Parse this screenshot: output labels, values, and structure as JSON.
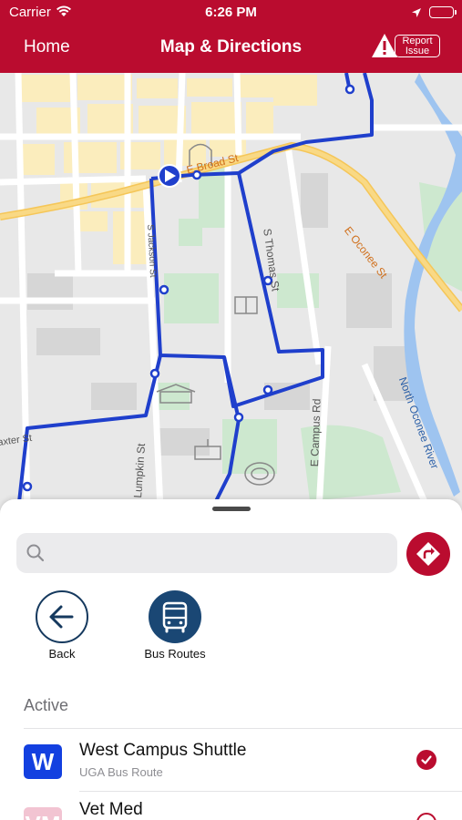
{
  "status_bar": {
    "carrier": "Carrier",
    "time": "6:26 PM"
  },
  "nav": {
    "home_label": "Home",
    "title": "Map & Directions",
    "report_label_line1": "Report",
    "report_label_line2": "Issue"
  },
  "map": {
    "street_labels": {
      "broad": "E Broad St",
      "thomas": "S Thomas St",
      "oconee": "E Oconee St",
      "campus": "E Campus Rd",
      "river": "North Oconee River",
      "lumpkin": "Lumpkin St",
      "jackson": "S Jackson St",
      "baxter": "Baxter St"
    },
    "colors": {
      "route": "#1f3fcc",
      "brand": "#ba0c2f"
    }
  },
  "search": {
    "placeholder": ""
  },
  "actions": {
    "back_label": "Back",
    "routes_label": "Bus Routes"
  },
  "list": {
    "section_title": "Active",
    "routes": [
      {
        "badge": "W",
        "name": "West Campus Shuttle",
        "subtitle": "UGA Bus Route",
        "color": "#1340e0",
        "checked": true
      },
      {
        "badge": "VM",
        "name": "Vet Med",
        "subtitle": "",
        "color": "#f2c4d2",
        "checked": false
      }
    ]
  }
}
